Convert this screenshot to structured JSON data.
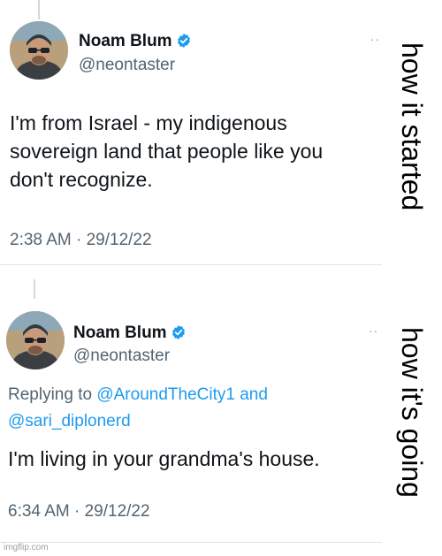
{
  "tweets": [
    {
      "author": "Noam Blum",
      "handle": "@neontaster",
      "text_lines": [
        "I'm from Israel - my indigenous",
        "sovereign land that people like you",
        "don't recognize."
      ],
      "timestamp": "2:38 AM · 29/12/22",
      "more": "··"
    },
    {
      "author": "Noam Blum",
      "handle": "@neontaster",
      "replying_prefix": "Replying to ",
      "reply_mentions": [
        "@AroundTheCity1",
        "@sari_diplonerd"
      ],
      "reply_joiner": " and",
      "text_lines": [
        "I'm living in your grandma's house."
      ],
      "timestamp": "6:34 AM · 29/12/22",
      "more": "··"
    }
  ],
  "labels": {
    "started": "how it started",
    "going": "how it's going"
  },
  "watermark": "imgflip.com",
  "colors": {
    "verified": "#1d9bf0",
    "link": "#1d9bf0",
    "secondary_text": "#536471"
  }
}
